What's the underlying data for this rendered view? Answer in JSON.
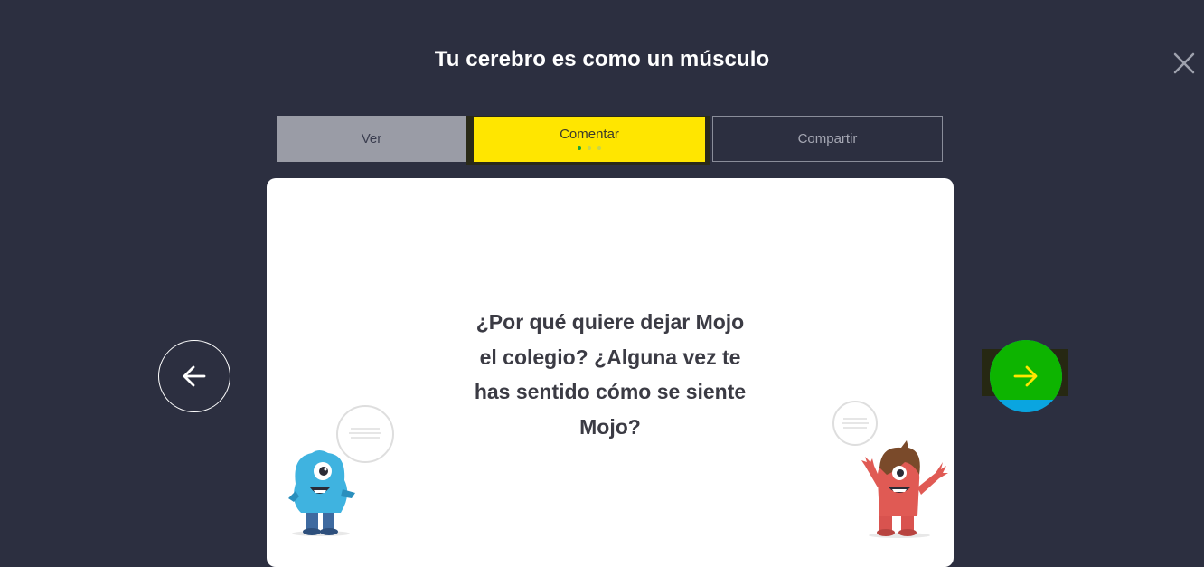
{
  "header": {
    "title": "Tu cerebro es como un músculo"
  },
  "tabs": [
    {
      "label": "Ver",
      "state": "done"
    },
    {
      "label": "Comentar",
      "state": "active",
      "step_dots": 3,
      "active_dot": 1
    },
    {
      "label": "Compartir",
      "state": "upcoming"
    }
  ],
  "card": {
    "question_lines": [
      "¿Por qué quiere dejar Mojo",
      "el colegio? ¿Alguna vez te",
      "has sentido cómo se siente",
      "Mojo?"
    ]
  },
  "icons": {
    "close": "close-icon",
    "prev": "arrow-left-icon",
    "next": "arrow-right-icon"
  },
  "colors": {
    "background": "#2c2f40",
    "active_tab": "#ffe600",
    "next_button": "#0db400",
    "next_button_accent": "#0aa5e0"
  }
}
